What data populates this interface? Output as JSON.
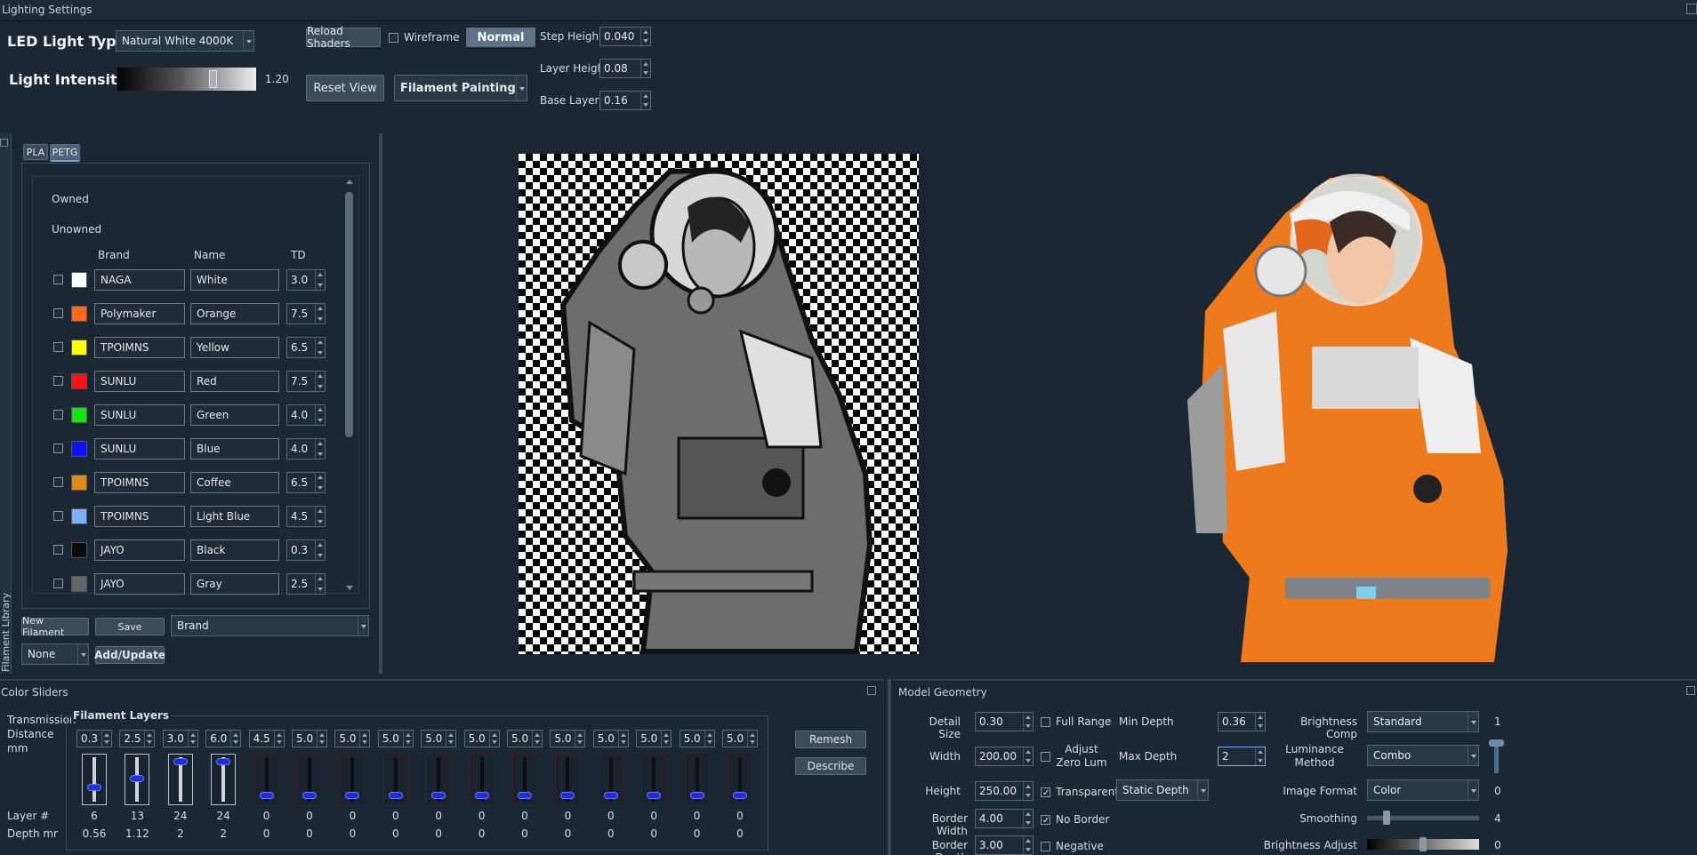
{
  "window": {
    "title": "Lighting Settings"
  },
  "lighting": {
    "led_label": "LED Light Type",
    "led_value": "Natural White 4000K",
    "intensity_label": "Light Intensity",
    "intensity_value": "1.20",
    "intensity_fraction": 0.7,
    "reload_shaders": "Reload Shaders",
    "wireframe": "Wireframe",
    "normal": "Normal",
    "reset_view": "Reset View",
    "mode_value": "Filament Painting",
    "step_height_label": "Step Height",
    "step_height": "0.040",
    "layer_height_label": "Layer Heigh",
    "layer_height": "0.08",
    "base_layer_label": "Base Layer",
    "base_layer": "0.16"
  },
  "library": {
    "side_label": "Filament Library",
    "tabs": [
      "PLA",
      "PETG"
    ],
    "owned": "Owned",
    "unowned": "Unowned",
    "headers": {
      "brand": "Brand",
      "name": "Name",
      "td": "TD"
    },
    "rows": [
      {
        "brand": "NAGA",
        "name": "White",
        "td": "3.0",
        "color": "#ffffff"
      },
      {
        "brand": "Polymaker",
        "name": "Orange",
        "td": "7.5",
        "color": "#ff6a1a"
      },
      {
        "brand": "TPOIMNS",
        "name": "Yellow",
        "td": "6.5",
        "color": "#ffff00"
      },
      {
        "brand": "SUNLU",
        "name": "Red",
        "td": "7.5",
        "color": "#ff1010"
      },
      {
        "brand": "SUNLU",
        "name": "Green",
        "td": "4.0",
        "color": "#12e612"
      },
      {
        "brand": "SUNLU",
        "name": "Blue",
        "td": "4.0",
        "color": "#0a14ff"
      },
      {
        "brand": "TPOIMNS",
        "name": "Coffee",
        "td": "6.5",
        "color": "#e08a18"
      },
      {
        "brand": "TPOIMNS",
        "name": "Light Blue",
        "td": "4.5",
        "color": "#7fb0ff"
      },
      {
        "brand": "JAYO",
        "name": "Black",
        "td": "0.3",
        "color": "#0a0a0a"
      },
      {
        "brand": "JAYO",
        "name": "Gray",
        "td": "2.5",
        "color": "#666666"
      }
    ],
    "new_filament": "New Filament",
    "save": "Save",
    "sort_value": "Brand",
    "none_value": "None",
    "add_update": "Add/Update"
  },
  "color_sliders": {
    "title": "Color Sliders",
    "transmission_label": "Transmission Distance mm",
    "filament_layers": "Filament Layers",
    "td_values": [
      "0.3",
      "2.5",
      "3.0",
      "6.0",
      "4.5",
      "5.0",
      "5.0",
      "5.0",
      "5.0",
      "5.0",
      "5.0",
      "5.0",
      "5.0",
      "5.0",
      "5.0",
      "5.0"
    ],
    "slider_levels": [
      0.3,
      0.55,
      1.0,
      1.0,
      0.1,
      0.1,
      0.1,
      0.1,
      0.1,
      0.1,
      0.1,
      0.1,
      0.1,
      0.1,
      0.1,
      0.1
    ],
    "layer_label": "Layer #",
    "depth_label": "Depth mr",
    "layers": [
      "6",
      "13",
      "24",
      "24",
      "0",
      "0",
      "0",
      "0",
      "0",
      "0",
      "0",
      "0",
      "0",
      "0",
      "0",
      "0"
    ],
    "depths": [
      "0.56",
      "1.12",
      "2",
      "2",
      "0",
      "0",
      "0",
      "0",
      "0",
      "0",
      "0",
      "0",
      "0",
      "0",
      "0",
      "0"
    ],
    "remesh": "Remesh",
    "describe": "Describe"
  },
  "model_geometry": {
    "title": "Model Geometry",
    "detail_size_label": "Detail Size",
    "detail_size": "0.30",
    "width_label": "Width",
    "width": "200.00",
    "height_label": "Height",
    "height": "250.00",
    "border_width_label": "Border Width",
    "border_width": "4.00",
    "border_depth_label": "Border Depth",
    "border_depth": "3.00",
    "full_range": "Full Range",
    "adjust_zero_lum": "Adjust Zero Lum",
    "transparent": "Transparent",
    "no_border": "No Border",
    "negative": "Negative",
    "min_depth_label": "Min Depth",
    "min_depth": "0.36",
    "max_depth_label": "Max Depth",
    "max_depth": "2",
    "static_depth": "Static Depth",
    "brightness_comp_label": "Brightness Comp",
    "brightness_comp": "Standard",
    "brightness_comp_num": "1",
    "luminance_method_label": "Luminance Method",
    "luminance_method": "Combo",
    "image_format_label": "Image Format",
    "image_format": "Color",
    "image_format_num": "0",
    "smoothing_label": "Smoothing",
    "smoothing_num": "4",
    "smoothing_fraction": 0.15,
    "brightness_adjust_label": "Brightness Adjust",
    "brightness_adjust_num": "0",
    "brightness_adjust_fraction": 0.5
  }
}
